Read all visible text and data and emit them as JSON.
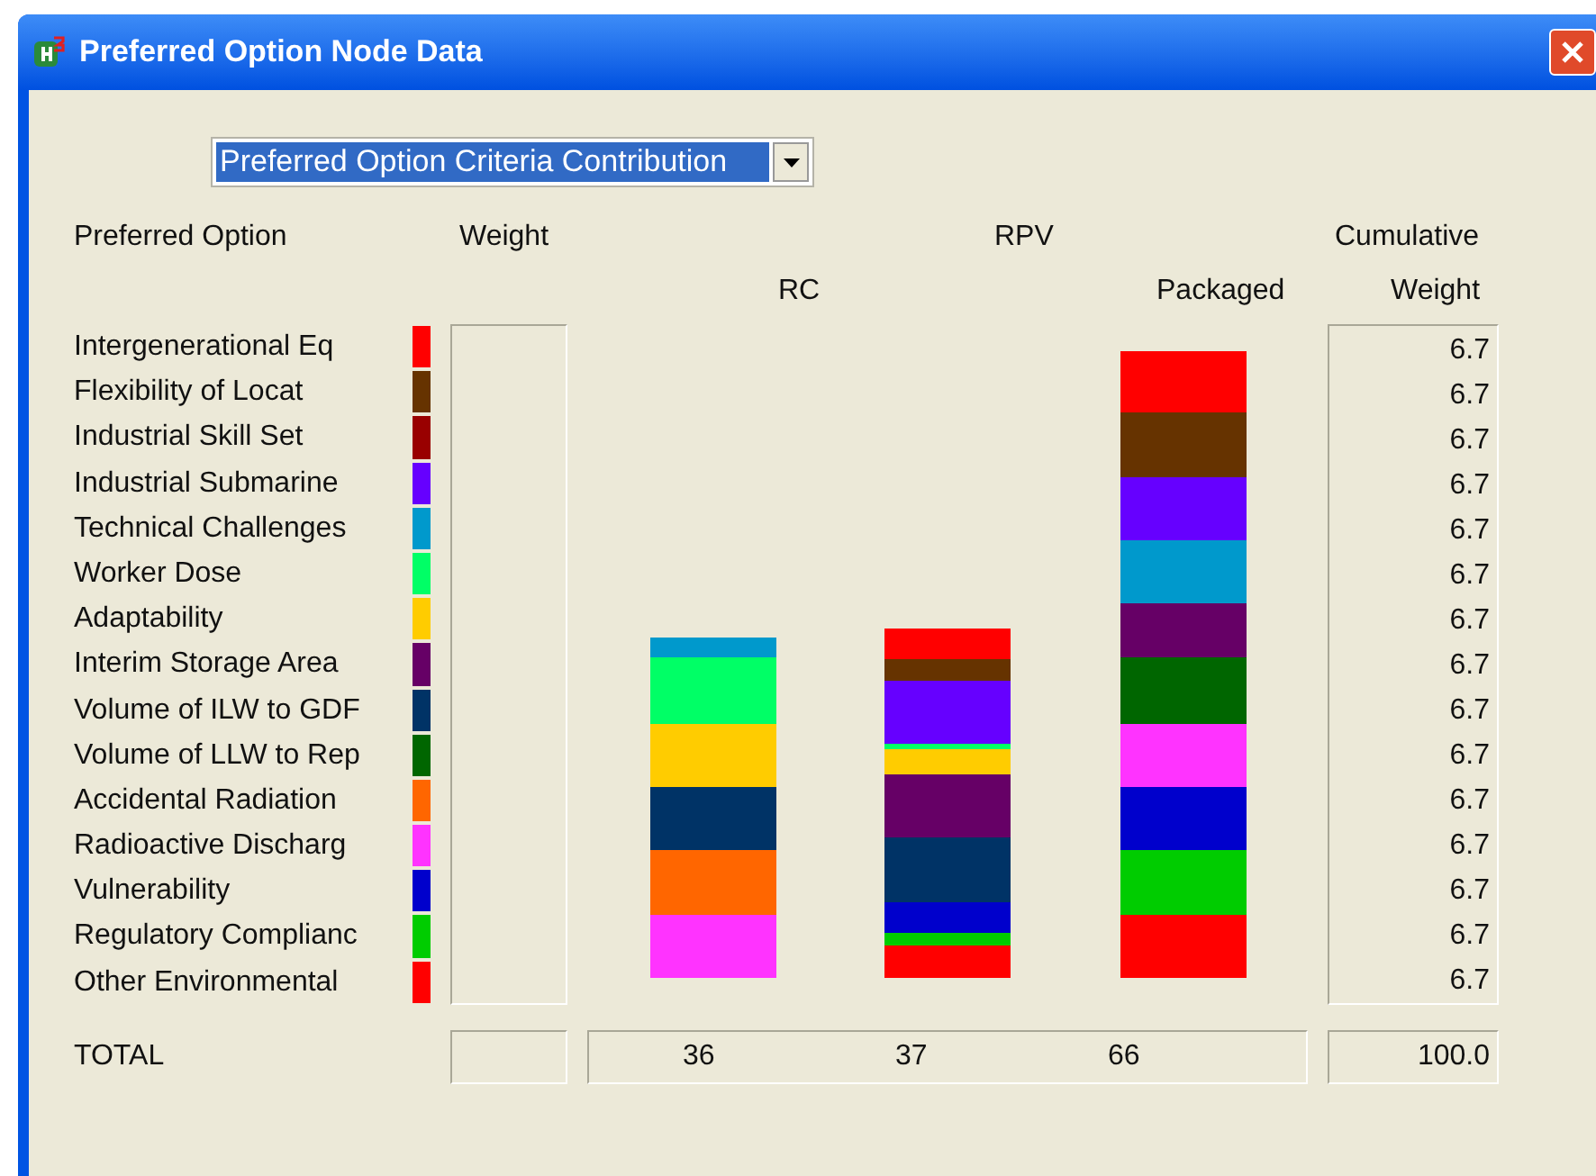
{
  "window": {
    "title": "Preferred Option Node Data"
  },
  "view_select": {
    "value": "Preferred Option Criteria Contribution"
  },
  "headers": {
    "option": "Preferred Option",
    "weight": "Weight",
    "group": "RPV",
    "cumulative_top": "Cumulative",
    "rc": "RC",
    "packaged": "Packaged",
    "cumulative_bottom": "Weight"
  },
  "criteria": [
    {
      "name": "Intergenerational Eq",
      "color": "#ff0000"
    },
    {
      "name": "Flexibility of Locat",
      "color": "#663300"
    },
    {
      "name": "Industrial Skill Set",
      "color": "#990000"
    },
    {
      "name": "Industrial Submarine",
      "color": "#6600ff"
    },
    {
      "name": "Technical Challenges",
      "color": "#0099cc"
    },
    {
      "name": "Worker Dose",
      "color": "#00ff66"
    },
    {
      "name": "Adaptability",
      "color": "#ffcc00"
    },
    {
      "name": "Interim Storage Area",
      "color": "#660066"
    },
    {
      "name": "Volume of ILW to GDF",
      "color": "#003366"
    },
    {
      "name": "Volume of LLW to Rep",
      "color": "#006600"
    },
    {
      "name": "Accidental Radiation",
      "color": "#ff6600"
    },
    {
      "name": "Radioactive Discharg",
      "color": "#ff33ff"
    },
    {
      "name": "Vulnerability",
      "color": "#0000cc"
    },
    {
      "name": "Regulatory Complianc",
      "color": "#00cc00"
    },
    {
      "name": "Other Environmental",
      "color": "#ff0000"
    }
  ],
  "cumulative": [
    "6.7",
    "6.7",
    "6.7",
    "6.7",
    "6.7",
    "6.7",
    "6.7",
    "6.7",
    "6.7",
    "6.7",
    "6.7",
    "6.7",
    "6.7",
    "6.7",
    "6.7"
  ],
  "totals": {
    "label": "TOTAL",
    "values": [
      "36",
      "37",
      "66"
    ],
    "cumulative": "100.0"
  }
}
